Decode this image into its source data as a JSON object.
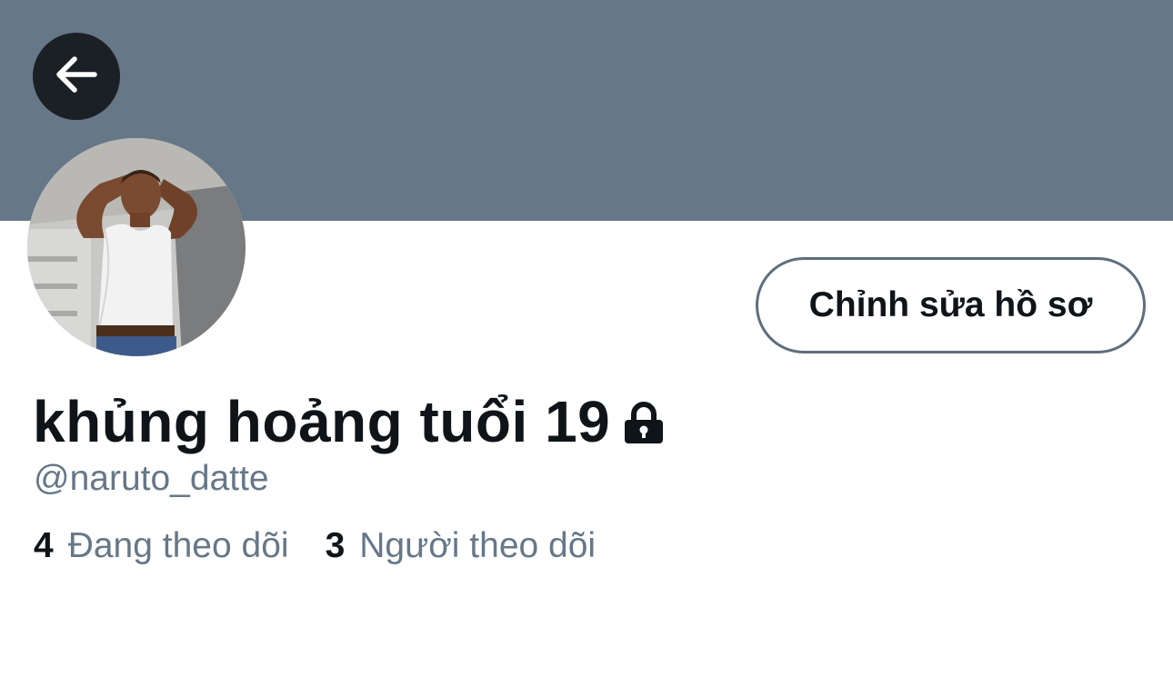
{
  "banner": {
    "color": "#667788"
  },
  "header": {
    "back_icon": "arrow-left-icon"
  },
  "profile": {
    "display_name": "khủng hoảng tuổi 19",
    "handle": "@naruto_datte",
    "protected_icon": "lock-icon",
    "avatar": "person-in-white-tank-top-holding-head"
  },
  "actions": {
    "edit_profile_label": "Chỉnh sửa hồ sơ"
  },
  "stats": {
    "following_count": "4",
    "following_label": "Đang theo dõi",
    "followers_count": "3",
    "followers_label": "Người theo dõi"
  },
  "colors": {
    "banner": "#667788",
    "text_primary": "#0f1419",
    "text_secondary": "#667788",
    "back_button_bg": "#1b2025"
  }
}
